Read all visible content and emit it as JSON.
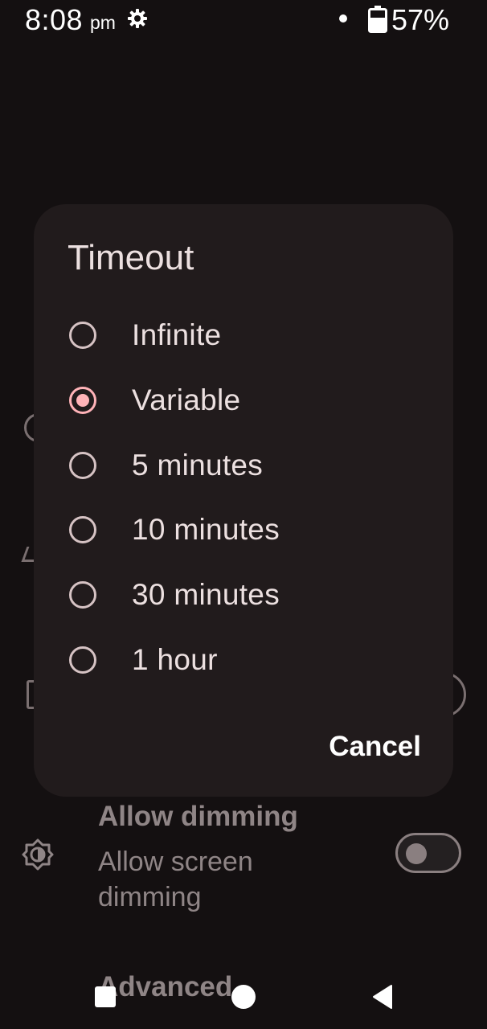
{
  "status_bar": {
    "time": "8:08",
    "ampm": "pm",
    "battery": "57%",
    "icons": [
      "settings-gear-icon",
      "notification-dot-icon",
      "battery-icon"
    ]
  },
  "background": {
    "setting": {
      "title": "Allow dimming",
      "summary": "Allow screen dimming",
      "toggle_on": false
    },
    "section_header": "Advanced"
  },
  "dialog": {
    "title": "Timeout",
    "options": [
      {
        "label": "Infinite",
        "selected": false
      },
      {
        "label": "Variable",
        "selected": true
      },
      {
        "label": "5 minutes",
        "selected": false
      },
      {
        "label": "10 minutes",
        "selected": false
      },
      {
        "label": "30 minutes",
        "selected": false
      },
      {
        "label": "1 hour",
        "selected": false
      }
    ],
    "cancel_label": "Cancel"
  },
  "colors": {
    "accent": "#ffb3b8",
    "dialog_bg": "#211b1c",
    "scrim_bg": "#141011"
  },
  "nav_bar": {
    "icons": [
      "recents-icon",
      "home-icon",
      "back-icon"
    ]
  }
}
